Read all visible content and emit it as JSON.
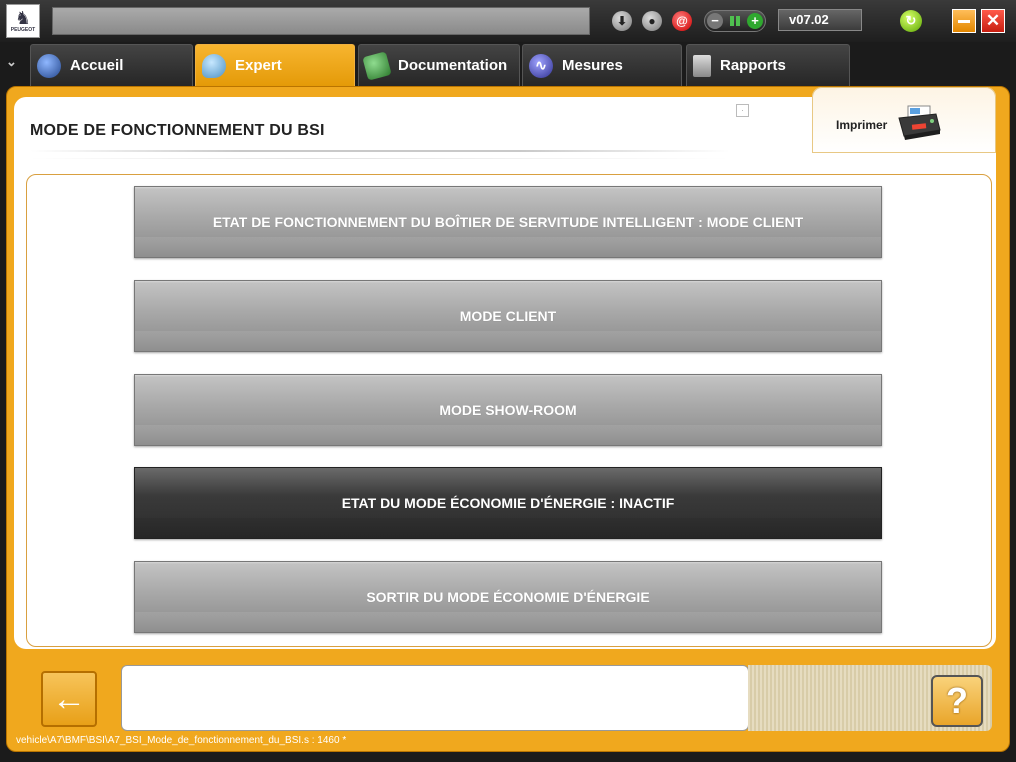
{
  "titlebar": {
    "logo_text": "PEUGEOT",
    "version": "v07.02",
    "minimize_label": "–",
    "close_label": "✕"
  },
  "tabs": [
    {
      "label": "Accueil",
      "icon": "home-globe-icon",
      "active": false
    },
    {
      "label": "Expert",
      "icon": "magnifier-icon",
      "active": true
    },
    {
      "label": "Documentation",
      "icon": "book-icon",
      "active": false
    },
    {
      "label": "Mesures",
      "icon": "waveform-icon",
      "active": false
    },
    {
      "label": "Rapports",
      "icon": "report-icon",
      "active": false
    }
  ],
  "page": {
    "title": "MODE DE FONCTIONNEMENT DU BSI",
    "print_label": "Imprimer"
  },
  "menu": {
    "items": [
      {
        "label": "ETAT DE FONCTIONNEMENT DU BOÎTIER DE SERVITUDE INTELLIGENT : MODE CLIENT",
        "selected": false
      },
      {
        "label": "MODE CLIENT",
        "selected": false
      },
      {
        "label": "MODE SHOW-ROOM",
        "selected": false
      },
      {
        "label": "ETAT DU MODE ÉCONOMIE D'ÉNERGIE : INACTIF",
        "selected": true
      },
      {
        "label": "SORTIR DU MODE ÉCONOMIE D'ÉNERGIE",
        "selected": false
      }
    ]
  },
  "footer": {
    "back_label": "←",
    "help_label": "?",
    "status_text": "",
    "path": "vehicle\\A7\\BMF\\BSI\\A7_BSI_Mode_de_fonctionnement_du_BSI.s : 1460 *"
  },
  "colors": {
    "accent": "#f0a81e",
    "button_grey": "#9a9a9a",
    "button_selected": "#2b2b2b"
  }
}
